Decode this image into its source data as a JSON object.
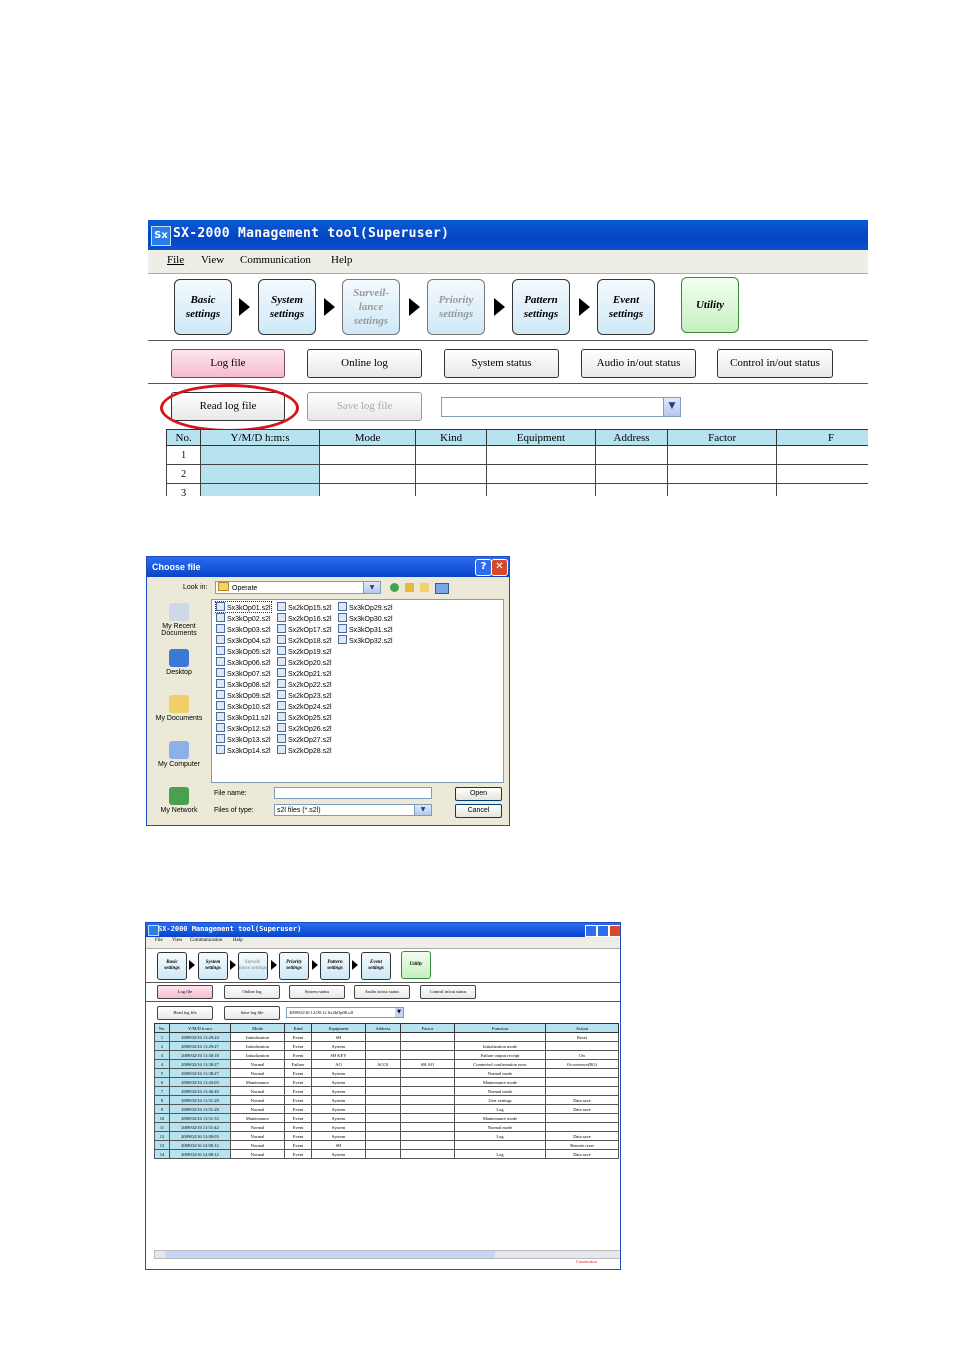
{
  "app": {
    "title": "SX-2000 Management tool(Superuser)",
    "icon_text": "Sx",
    "menu": [
      "File",
      "View",
      "Communication",
      "Help"
    ],
    "steps": [
      {
        "label": "Basic settings",
        "state": "normal"
      },
      {
        "label": "System settings",
        "state": "normal"
      },
      {
        "label": "Surveil- lance settings",
        "state": "disabled"
      },
      {
        "label": "Priority settings",
        "state": "disabled"
      },
      {
        "label": "Pattern settings",
        "state": "normal"
      },
      {
        "label": "Event settings",
        "state": "normal"
      },
      {
        "label": "Utility",
        "state": "utility"
      }
    ],
    "tabs": [
      "Log file",
      "Online log",
      "System status",
      "Audio in/out status",
      "Control in/out status"
    ],
    "actions": {
      "read": "Read log file",
      "save": "Save log file"
    },
    "columns": [
      "No.",
      "Y/M/D h:m:s",
      "Mode",
      "Kind",
      "Equipment",
      "Address",
      "Factor",
      "F"
    ],
    "row_numbers": [
      "1",
      "2",
      "3"
    ]
  },
  "dialog": {
    "title": "Choose file",
    "look_in_label": "Look in:",
    "look_in_value": "Operate",
    "places": [
      "My Recent Documents",
      "Desktop",
      "My Documents",
      "My Computer",
      "My Network"
    ],
    "files": [
      "Sx3kOp01.s2l",
      "Sx3kOp02.s2l",
      "Sx3kOp03.s2l",
      "Sx3kOp04.s2l",
      "Sx3kOp05.s2l",
      "Sx3kOp06.s2l",
      "Sx3kOp07.s2l",
      "Sx3kOp08.s2l",
      "Sx3kOp09.s2l",
      "Sx3kOp10.s2l",
      "Sx3kOp11.s2l",
      "Sx3kOp12.s2l",
      "Sx3kOp13.s2l",
      "Sx3kOp14.s2l",
      "Sx2kOp15.s2l",
      "Sx2kOp16.s2l",
      "Sx2kOp17.s2l",
      "Sx2kOp18.s2l",
      "Sx2kOp19.s2l",
      "Sx2kOp20.s2l",
      "Sx2kOp21.s2l",
      "Sx2kOp22.s2l",
      "Sx2kOp23.s2l",
      "Sx2kOp24.s2l",
      "Sx2kOp25.s2l",
      "Sx2kOp26.s2l",
      "Sx2kOp27.s2l",
      "Sx2kOp28.s2l",
      "Sx3kOp29.s2l",
      "Sx3kOp30.s2l",
      "Sx3kOp31.s2l",
      "Sx3kOp32.s2l"
    ],
    "file_name_label": "File name:",
    "file_name_value": "",
    "file_type_label": "Files of type:",
    "file_type_value": "s2l files (*.s2l)",
    "open": "Open",
    "cancel": "Cancel"
  },
  "log_window": {
    "combo_value": "2009/02/16 12:00:12   Sx2kOp08.s2l",
    "columns": [
      "No.",
      "Y/M/D h:m:s",
      "Mode",
      "Kind",
      "Equipment",
      "Address",
      "Factor",
      "Function",
      "Action"
    ],
    "rows": [
      [
        "1",
        "2009/02/16 11:29:24",
        "Initialization",
        "Event",
        "SH",
        "",
        "",
        "",
        "Reset"
      ],
      [
        "2",
        "2009/02/16 11:29:27",
        "Initialization",
        "Event",
        "System",
        "",
        "",
        "Initialization mode",
        ""
      ],
      [
        "3",
        "2009/02/16 11:30:18",
        "Initialization",
        "Event",
        "SH KEY",
        "",
        "",
        "Failure output receipt",
        "On"
      ],
      [
        "4",
        "2009/02/16 11:38:27",
        "Normal",
        "Failure",
        "AO",
        "ACO1",
        "SH.AO",
        "Connected confirmation error",
        "Occurrence(RG)"
      ],
      [
        "5",
        "2009/02/16 11:38:27",
        "Normal",
        "Event",
        "System",
        "",
        "",
        "Normal mode",
        ""
      ],
      [
        "6",
        "2009/02/16 11:43:03",
        "Maintenance",
        "Event",
        "System",
        "",
        "",
        "Maintenance mode",
        ""
      ],
      [
        "7",
        "2009/02/16 11:46:40",
        "Normal",
        "Event",
        "System",
        "",
        "",
        "Normal mode",
        ""
      ],
      [
        "8",
        "2009/02/16 11:51:28",
        "Normal",
        "Event",
        "System",
        "",
        "",
        "User settings",
        "Data save"
      ],
      [
        "9",
        "2009/02/16 11:51:28",
        "Normal",
        "Event",
        "System",
        "",
        "",
        "Log",
        "Data save"
      ],
      [
        "10",
        "2009/02/16 11:51:33",
        "Maintenance",
        "Event",
        "System",
        "",
        "",
        "Maintenance mode",
        ""
      ],
      [
        "11",
        "2009/02/16 11:51:42",
        "Normal",
        "Event",
        "System",
        "",
        "",
        "Normal mode",
        ""
      ],
      [
        "12",
        "2009/02/16 12:00:03",
        "Normal",
        "Event",
        "System",
        "",
        "",
        "Log",
        "Data save"
      ],
      [
        "13",
        "2009/02/16 12:00:12",
        "Normal",
        "Event",
        "SH",
        "",
        "",
        "",
        "Remote reset"
      ],
      [
        "14",
        "2009/02/16 12:00:12",
        "Normal",
        "Event",
        "System",
        "",
        "",
        "Log",
        "Data save"
      ]
    ],
    "status": "Connection"
  }
}
